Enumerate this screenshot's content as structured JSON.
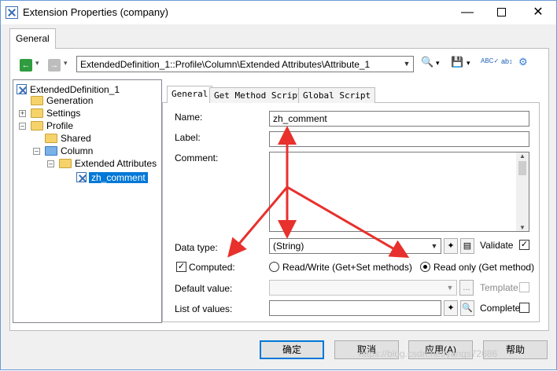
{
  "window": {
    "title": "Extension Properties (company)"
  },
  "outer_tab": "General",
  "path": "ExtendedDefinition_1::Profile\\Column\\Extended Attributes\\Attribute_1",
  "tree": {
    "root": "ExtendedDefinition_1",
    "generation": "Generation",
    "settings": "Settings",
    "profile": "Profile",
    "shared": "Shared",
    "column": "Column",
    "extended_attributes": "Extended Attributes",
    "selected": "zh_comment"
  },
  "inner_tabs": [
    "General",
    "Get Method Script",
    "Global Script"
  ],
  "form": {
    "name_label": "Name:",
    "name_value": "zh_comment",
    "label_label": "Label:",
    "comment_label": "Comment:",
    "datatype_label": "Data type:",
    "datatype_value": "(String)",
    "validate_label": "Validate",
    "computed_label": "Computed:",
    "readwrite_label": "Read/Write (Get+Set methods)",
    "readonly_label": "Read only (Get method)",
    "default_label": "Default value:",
    "template_label": "Template",
    "list_label": "List of values:",
    "complete_label": "Complete"
  },
  "buttons": {
    "ok": "确定",
    "cancel": "取消",
    "apply": "应用(A)",
    "help": "帮助"
  },
  "watermark": "https://blog.csdn.net/yangs72686"
}
